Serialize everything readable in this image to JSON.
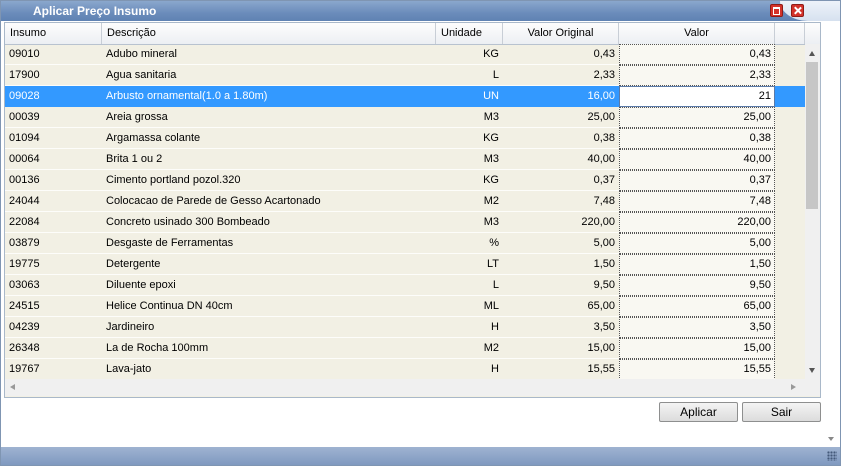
{
  "window": {
    "title": "Aplicar Preço Insumo"
  },
  "columns": [
    "Insumo",
    "Descrição",
    "Unidade",
    "Valor Original",
    "Valor"
  ],
  "rows": [
    {
      "insumo": "09010",
      "descricao": "Adubo mineral",
      "unidade": "KG",
      "original": "0,43",
      "valor": "0,43"
    },
    {
      "insumo": "17900",
      "descricao": "Agua sanitaria",
      "unidade": "L",
      "original": "2,33",
      "valor": "2,33"
    },
    {
      "insumo": "09028",
      "descricao": "Arbusto ornamental(1.0 a 1.80m)",
      "unidade": "UN",
      "original": "16,00",
      "valor": "21"
    },
    {
      "insumo": "00039",
      "descricao": "Areia grossa",
      "unidade": "M3",
      "original": "25,00",
      "valor": "25,00"
    },
    {
      "insumo": "01094",
      "descricao": "Argamassa colante",
      "unidade": "KG",
      "original": "0,38",
      "valor": "0,38"
    },
    {
      "insumo": "00064",
      "descricao": "Brita 1 ou 2",
      "unidade": "M3",
      "original": "40,00",
      "valor": "40,00"
    },
    {
      "insumo": "00136",
      "descricao": "Cimento portland pozol.320",
      "unidade": "KG",
      "original": "0,37",
      "valor": "0,37"
    },
    {
      "insumo": "24044",
      "descricao": "Colocacao de Parede de Gesso Acartonado",
      "unidade": "M2",
      "original": "7,48",
      "valor": "7,48"
    },
    {
      "insumo": "22084",
      "descricao": "Concreto usinado 300 Bombeado",
      "unidade": "M3",
      "original": "220,00",
      "valor": "220,00"
    },
    {
      "insumo": "03879",
      "descricao": "Desgaste de Ferramentas",
      "unidade": "%",
      "original": "5,00",
      "valor": "5,00"
    },
    {
      "insumo": "19775",
      "descricao": "Detergente",
      "unidade": "LT",
      "original": "1,50",
      "valor": "1,50"
    },
    {
      "insumo": "03063",
      "descricao": "Diluente epoxi",
      "unidade": "L",
      "original": "9,50",
      "valor": "9,50"
    },
    {
      "insumo": "24515",
      "descricao": "Helice Continua DN 40cm",
      "unidade": "ML",
      "original": "65,00",
      "valor": "65,00"
    },
    {
      "insumo": "04239",
      "descricao": "Jardineiro",
      "unidade": "H",
      "original": "3,50",
      "valor": "3,50"
    },
    {
      "insumo": "26348",
      "descricao": "La de Rocha 100mm",
      "unidade": "M2",
      "original": "15,00",
      "valor": "15,00"
    },
    {
      "insumo": "19767",
      "descricao": "Lava-jato",
      "unidade": "H",
      "original": "15,55",
      "valor": "15,55"
    }
  ],
  "selected_index": 2,
  "buttons": {
    "apply": "Aplicar",
    "exit": "Sair"
  },
  "colors": {
    "selection": "#3399ff",
    "titlebar": "#6b8cbb",
    "close": "#d3322a",
    "grid_bg": "#f2f0e4"
  }
}
